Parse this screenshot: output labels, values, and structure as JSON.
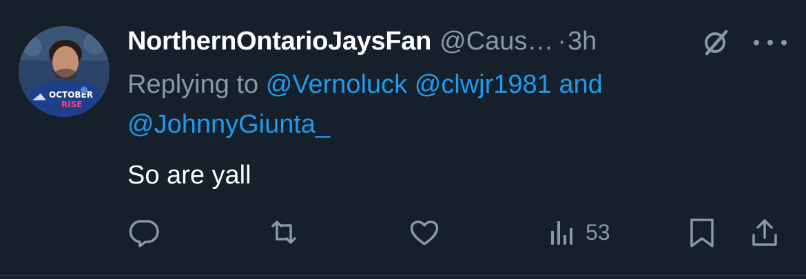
{
  "tweet": {
    "display_name": "NorthernOntarioJaysFan",
    "handle": "@Caus…",
    "separator": "·",
    "time": "3h",
    "replying_prefix": "Replying to",
    "mentions": [
      "@Vernoluck",
      "@clwjr1981"
    ],
    "and_word": "and",
    "mention_last": "@JohnnyGiunta_",
    "text": "So are yall",
    "avatar_shirt_text_1": "OCTOBER",
    "avatar_shirt_text_2": "RISE"
  },
  "actions": {
    "views_count": "53"
  },
  "colors": {
    "background": "#16202b",
    "secondary_text": "#8b98a5",
    "link": "#1d9bf0",
    "primary_text": "#ffffff"
  },
  "icons": {
    "reply": "reply-icon",
    "retweet": "retweet-icon",
    "like": "heart-icon",
    "views": "views-icon",
    "bookmark": "bookmark-icon",
    "share": "share-icon",
    "grok": "grok-icon",
    "more": "more-icon"
  }
}
